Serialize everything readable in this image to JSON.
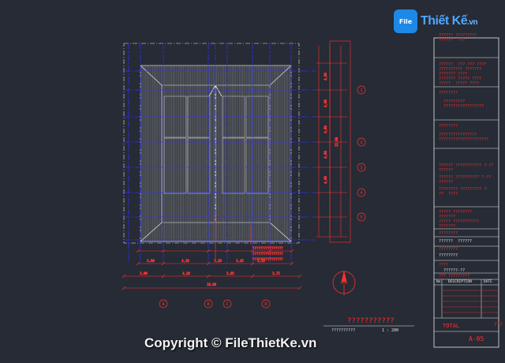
{
  "logo": {
    "badge_text": "File",
    "brand": "Thiết Kế",
    "domain": ".vn"
  },
  "watermark": "Copyright © FileThietKe.vn",
  "drawing": {
    "title": "???????????",
    "subtitle": "??????????",
    "scale": "1 : 200"
  },
  "title_block": {
    "lines_block1": [
      "?????? ?????????",
      "??????  ???"
    ],
    "lines_block2": [
      "??????  ??? ??? ????",
      "?????????? ???????",
      "??????? ????",
      "??????? ????? ????",
      "?????  ????? ????"
    ],
    "section1": "????????",
    "section1_lines": [
      "?????????",
      "?????????????????"
    ],
    "section2": "????????",
    "section2_lines": [
      "????????????????",
      "?????????????????????"
    ],
    "section3_lines": [
      "?????? ??????????? ?-??",
      "??????",
      "?????? ?????????? ?-??",
      "??????",
      "???????? ????????? ?-",
      "??  ????"
    ],
    "section4_lines": [
      "????? ????????",
      "???????",
      "????? ???????????",
      "???????"
    ],
    "section5": "????????",
    "section6": "??????  ??????",
    "section7": "????????",
    "section8": "????",
    "section8_line": "??????-??",
    "project_name": "??? ?????????",
    "rev_headers": [
      "No.",
      "DESCRIPTION",
      "DATE"
    ],
    "total": "TOTAL",
    "total_value": "???",
    "sheet_no": "A-05"
  },
  "grid_labels": {
    "bottom": [
      "A",
      "B",
      "C",
      "D"
    ],
    "right": [
      "1",
      "2",
      "3",
      "4",
      "5"
    ]
  },
  "dimensions": {
    "bottom_row1": [
      "3,00",
      "4,20",
      "1,20",
      "3,45",
      "3,15"
    ],
    "bottom_row2": [
      "3,00",
      "4,20",
      "5,85",
      "3,75"
    ],
    "bottom_total": "18,90",
    "right_segments": [
      "4,00",
      "4,00",
      "4,00",
      "4,00",
      "4,00"
    ],
    "right_total": "22,00"
  },
  "colors": {
    "background": "#262b35",
    "grid": "#2b2bff",
    "dimension": "#ff3030",
    "roof": "#c8c8c8",
    "frame": "#e6e6e6"
  }
}
